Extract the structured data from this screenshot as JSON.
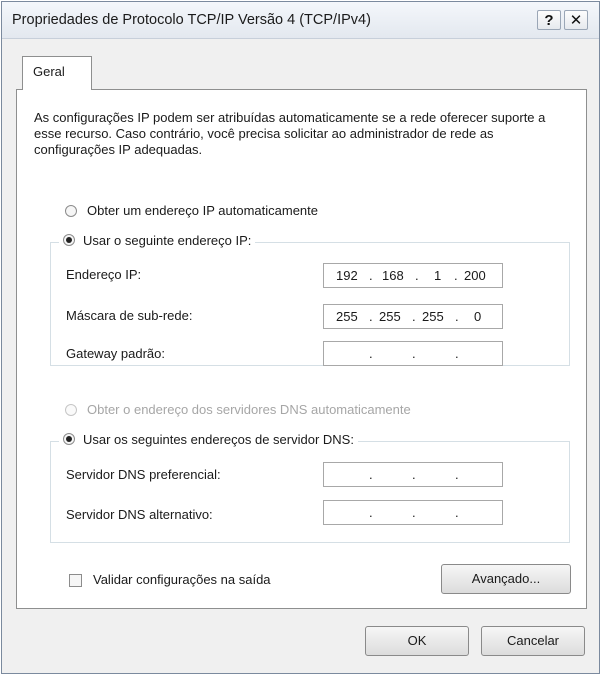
{
  "window": {
    "title": "Propriedades de Protocolo TCP/IP Versão 4 (TCP/IPv4)",
    "help_label": "?",
    "close_label": "✕"
  },
  "tabs": [
    {
      "label": "Geral"
    }
  ],
  "intro_text": "As configurações IP podem ser atribuídas automaticamente se a rede oferecer suporte a esse recurso. Caso contrário, você precisa solicitar ao administrador de rede as configurações IP adequadas.",
  "ip_section": {
    "auto_option": {
      "label": "Obter um endereço IP automaticamente",
      "selected": false
    },
    "manual_option": {
      "label": "Usar o seguinte endereço IP:",
      "selected": true
    },
    "fields": [
      {
        "label": "Endereço IP:",
        "octets": [
          "192",
          "168",
          "1",
          "200"
        ]
      },
      {
        "label": "Máscara de sub-rede:",
        "octets": [
          "255",
          "255",
          "255",
          "0"
        ]
      },
      {
        "label": "Gateway padrão:",
        "octets": [
          "",
          "",
          "",
          ""
        ]
      }
    ]
  },
  "dns_section": {
    "auto_option": {
      "label": "Obter o endereço dos servidores DNS automaticamente",
      "selected": false,
      "enabled": false
    },
    "manual_option": {
      "label": "Usar os seguintes endereços de servidor DNS:",
      "selected": true
    },
    "fields": [
      {
        "label": "Servidor DNS preferencial:",
        "octets": [
          "",
          "",
          "",
          ""
        ]
      },
      {
        "label": "Servidor DNS alternativo:",
        "octets": [
          "",
          "",
          "",
          ""
        ]
      }
    ]
  },
  "validate_checkbox": {
    "label": "Validar configurações na saída",
    "checked": false
  },
  "buttons": {
    "advanced": "Avançado...",
    "ok": "OK",
    "cancel": "Cancelar"
  }
}
